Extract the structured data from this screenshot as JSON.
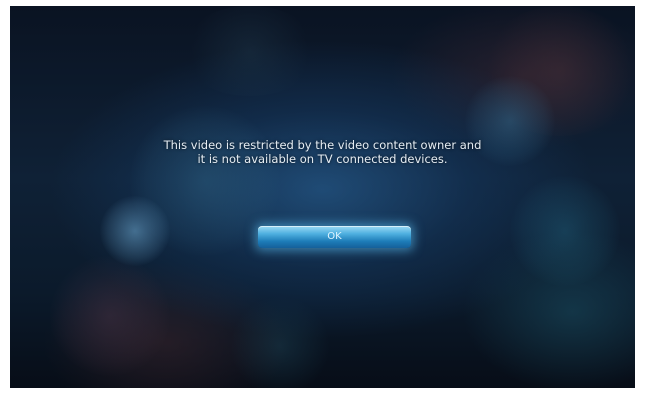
{
  "dialog": {
    "message": "This video is restricted by the video content owner and it is not available on TV connected devices.",
    "ok_label": "OK"
  },
  "colors": {
    "background": "#0f2136",
    "button_accent": "#4fb0e0",
    "text": "#e6edf3"
  }
}
